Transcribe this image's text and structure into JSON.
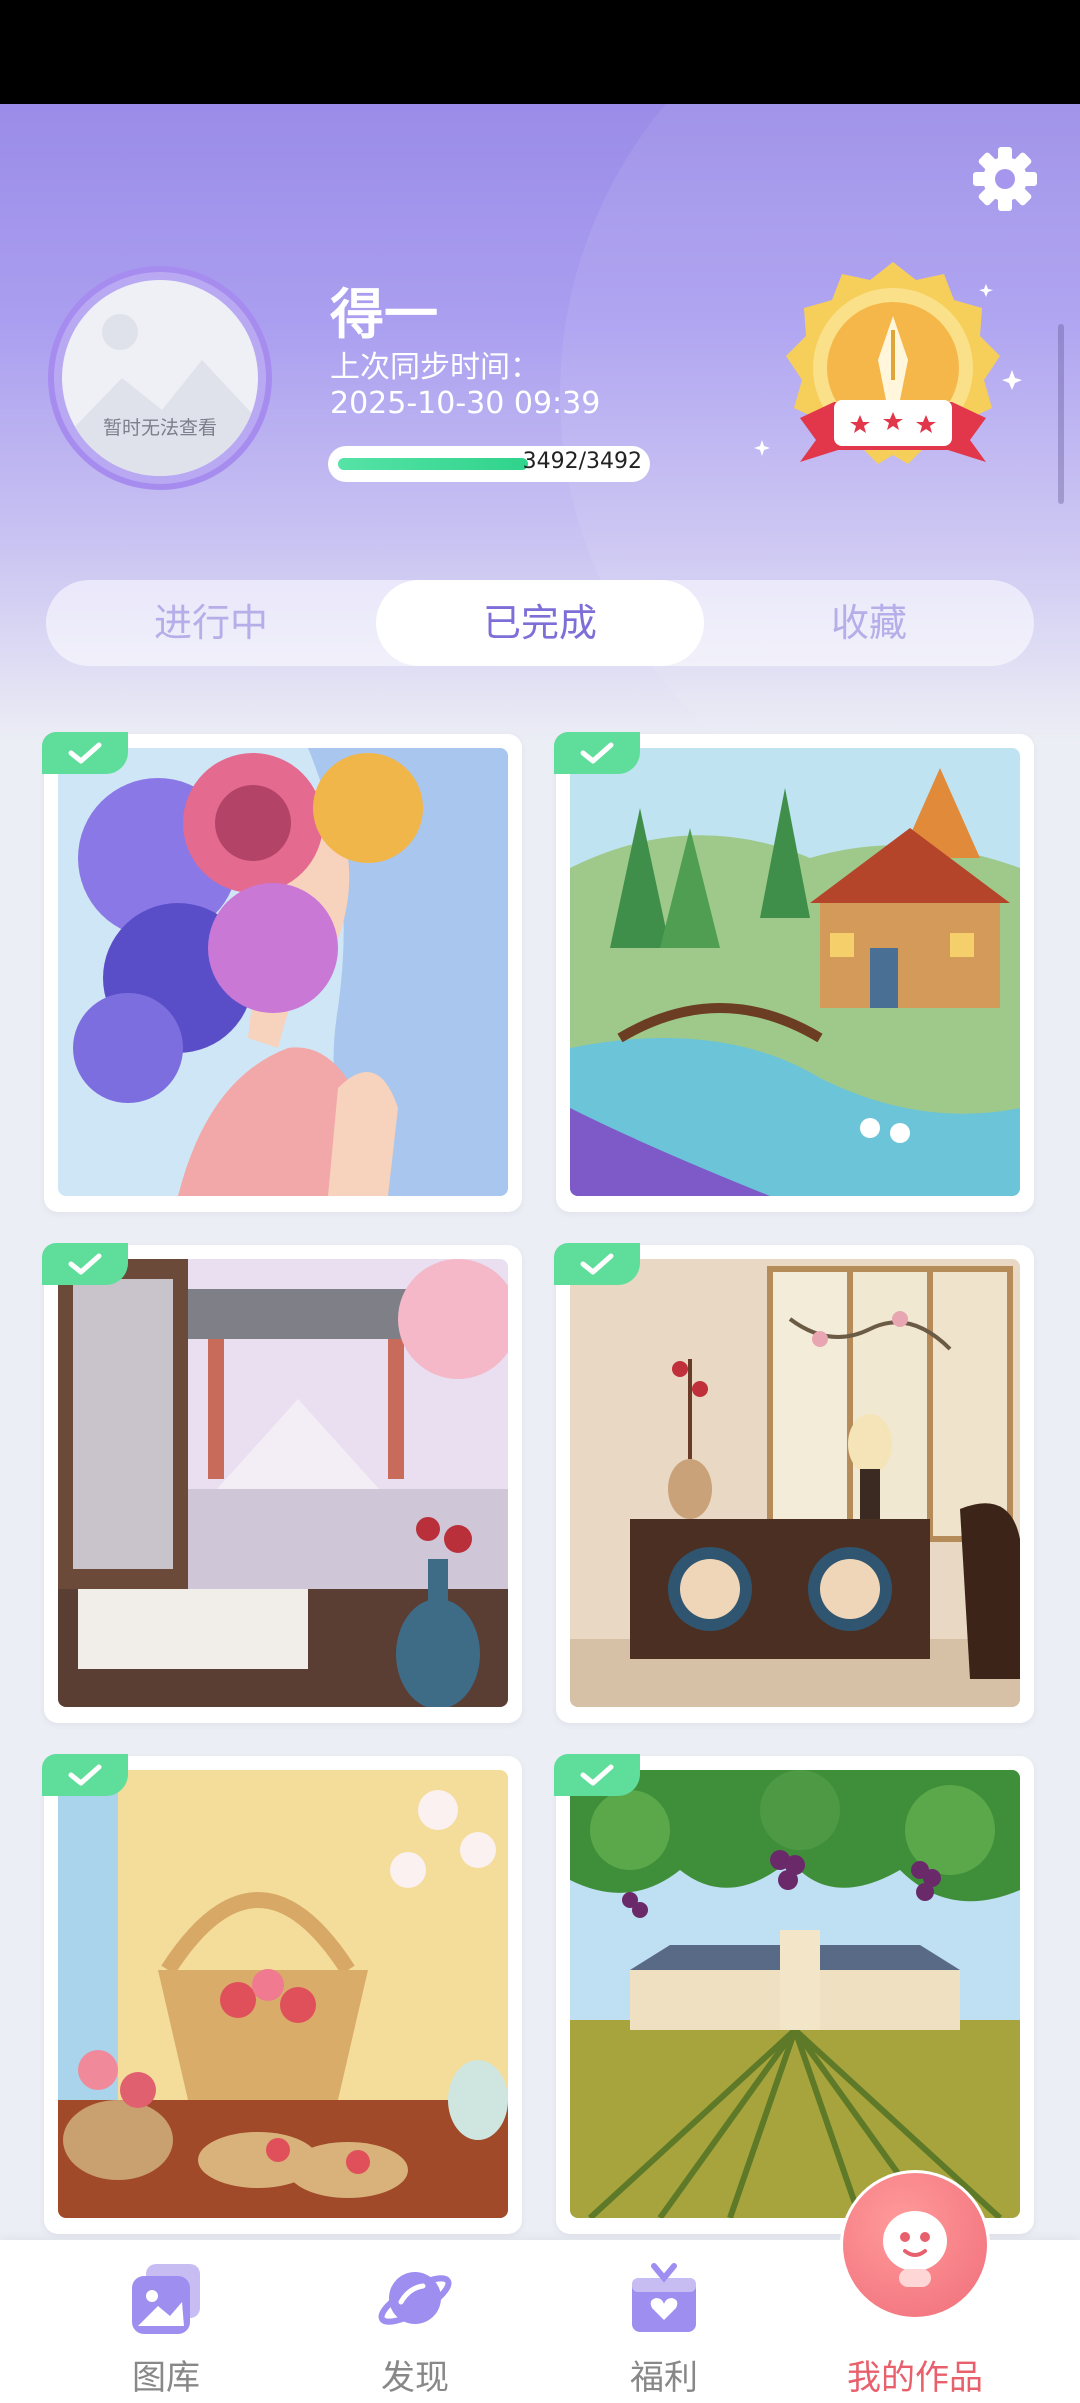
{
  "profile": {
    "name": "得一",
    "avatar_text": "暂时无法查看",
    "sync_label": "上次同步时间：",
    "sync_time": "2025-10-30 09:39",
    "progress_text": "3492/3492",
    "progress_fraction": 1.0
  },
  "tabs": [
    {
      "label": "进行中",
      "active": false
    },
    {
      "label": "已完成",
      "active": true
    },
    {
      "label": "收藏",
      "active": false
    }
  ],
  "artworks": [
    {
      "name": "flower-woman",
      "completed": true
    },
    {
      "name": "cottage-bridge",
      "completed": true
    },
    {
      "name": "japanese-room",
      "completed": true
    },
    {
      "name": "chinese-cabinet",
      "completed": true
    },
    {
      "name": "straw-bag",
      "completed": true
    },
    {
      "name": "vineyard",
      "completed": true
    }
  ],
  "nav": {
    "gallery": "图库",
    "discover": "发现",
    "welfare": "福利",
    "my_works": "我的作品"
  },
  "colors": {
    "accent": "#7e6fd8",
    "active_nav": "#e8606c",
    "check": "#5fdd9a"
  }
}
